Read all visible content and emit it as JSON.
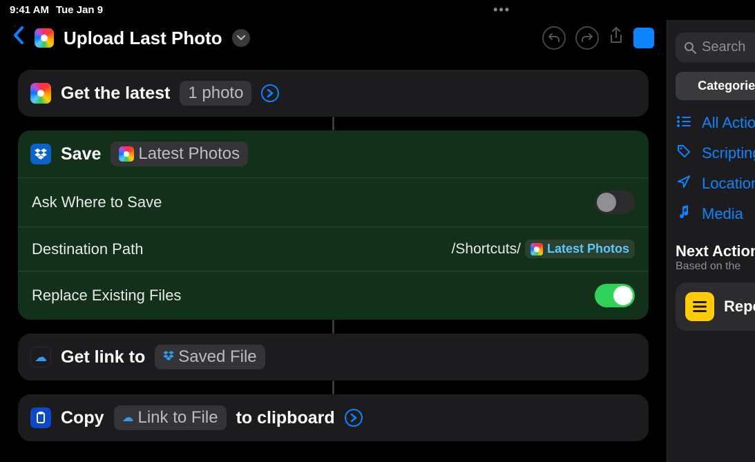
{
  "statusbar": {
    "time": "9:41 AM",
    "date": "Tue Jan 9"
  },
  "toolbar": {
    "title": "Upload Last Photo"
  },
  "actions": {
    "get_latest": {
      "title": "Get the latest",
      "param": "1 photo"
    },
    "save": {
      "title": "Save",
      "input_token": "Latest Photos",
      "rows": {
        "ask_label": "Ask Where to Save",
        "dest_label": "Destination Path",
        "dest_prefix": "/Shortcuts/",
        "dest_token": "Latest Photos",
        "replace_label": "Replace Existing Files"
      }
    },
    "getlink": {
      "title": "Get link to",
      "token": "Saved File"
    },
    "copy": {
      "title": "Copy",
      "token": "Link to File",
      "suffix": "to clipboard"
    }
  },
  "sidebar": {
    "search_placeholder": "Search",
    "categories_label": "Categories",
    "items": [
      {
        "icon": "list",
        "label": "All Actions"
      },
      {
        "icon": "tag",
        "label": "Scripting"
      },
      {
        "icon": "nav",
        "label": "Location"
      },
      {
        "icon": "note",
        "label": "Media"
      }
    ],
    "section_title": "Next Action",
    "section_sub": "Based on the",
    "suggestion": {
      "label": "Repeat"
    }
  }
}
